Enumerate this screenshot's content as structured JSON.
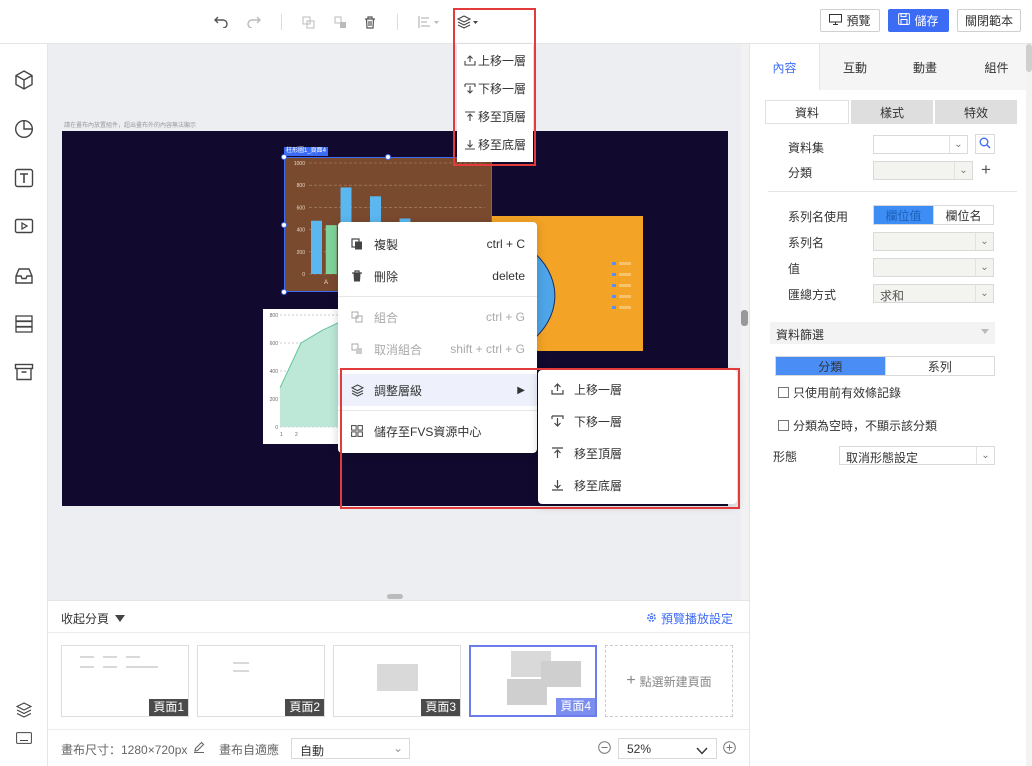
{
  "toolbar": {
    "preview_label": "預覽",
    "save_label": "儲存",
    "close_label": "關閉範本"
  },
  "layer_dropdown": {
    "items": [
      "上移一層",
      "下移一層",
      "移至頂層",
      "移至底層"
    ]
  },
  "canvas": {
    "hint": "請在畫布內放置組件，超出畫布外的內容無法顯示",
    "selected_tag": "柱形圖1_頁面4",
    "bar_chart": {
      "type": "bar",
      "y_ticks": [
        "1000",
        "800",
        "600",
        "400",
        "200",
        "0"
      ],
      "categories": [
        "A"
      ],
      "ylim": [
        0,
        1000
      ],
      "values": [
        480,
        440,
        780,
        420,
        700,
        460,
        500,
        430,
        400
      ]
    },
    "area_chart": {
      "type": "area",
      "y_ticks": [
        "800",
        "600",
        "400",
        "200",
        "0"
      ],
      "x_ticks": [
        "1",
        "2"
      ],
      "ylim": [
        0,
        800
      ],
      "values": [
        280,
        600,
        690,
        760
      ]
    }
  },
  "context_menu": {
    "items": [
      {
        "label": "複製",
        "shortcut": "ctrl + C"
      },
      {
        "label": "刪除",
        "shortcut": "delete"
      },
      {
        "label": "組合",
        "shortcut": "ctrl + G"
      },
      {
        "label": "取消組合",
        "shortcut": "shift + ctrl + G"
      },
      {
        "label": "調整層級"
      },
      {
        "label": "儲存至FVS資源中心"
      }
    ],
    "submenu": [
      "上移一層",
      "下移一層",
      "移至頂層",
      "移至底層"
    ]
  },
  "panel": {
    "tabs": [
      "內容",
      "互動",
      "動畫",
      "組件"
    ],
    "subtabs": [
      "資料",
      "樣式",
      "特效"
    ],
    "dataset_label": "資料集",
    "category_label": "分類",
    "series_name_use_label": "系列名使用",
    "series_toggle": [
      "欄位值",
      "欄位名"
    ],
    "series_name_label": "系列名",
    "value_label": "值",
    "agg_label": "匯總方式",
    "agg_value": "求和",
    "filter_label": "資料篩選",
    "filter_toggle": [
      "分類",
      "系列"
    ],
    "only_prev_label": "只使用前有效條記錄",
    "hide_empty_label": "分類為空時，不顯示該分類",
    "shape_label": "形態",
    "shape_value": "取消形態設定"
  },
  "pages": {
    "collapse_label": "收起分頁",
    "preview_settings_label": "預覽播放設定",
    "items": [
      "頁面1",
      "頁面2",
      "頁面3",
      "頁面4"
    ],
    "new_page_label": "點選新建頁面"
  },
  "statusbar": {
    "size_label": "畫布尺寸：1280×720px",
    "adapt_label": "畫布自適應",
    "adapt_value": "自動",
    "zoom": "52%"
  },
  "colors": {
    "accent": "#3d6cf4",
    "stage_bg": "#120a2e",
    "bar_chart_bg": "#7a4a2e",
    "pie_chart_bg": "#f3a325",
    "highlight_red": "#e23b3b"
  }
}
